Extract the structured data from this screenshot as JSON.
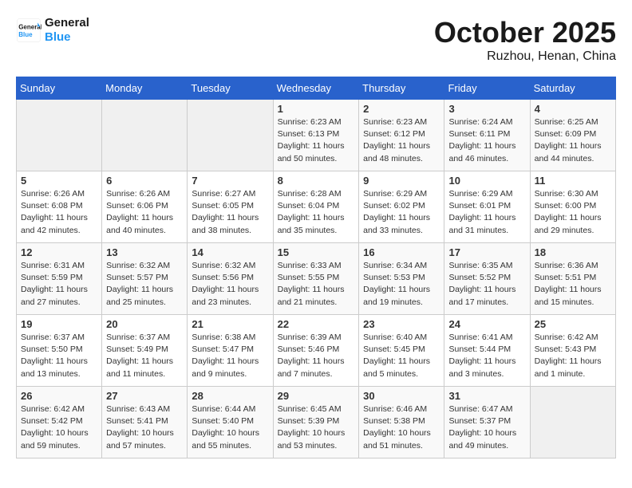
{
  "header": {
    "logo_line1": "General",
    "logo_line2": "Blue",
    "title": "October 2025",
    "subtitle": "Ruzhou, Henan, China"
  },
  "days_of_week": [
    "Sunday",
    "Monday",
    "Tuesday",
    "Wednesday",
    "Thursday",
    "Friday",
    "Saturday"
  ],
  "weeks": [
    [
      {
        "day": "",
        "empty": true
      },
      {
        "day": "",
        "empty": true
      },
      {
        "day": "",
        "empty": true
      },
      {
        "day": "1",
        "sunrise": "6:23 AM",
        "sunset": "6:13 PM",
        "daylight": "11 hours and 50 minutes."
      },
      {
        "day": "2",
        "sunrise": "6:23 AM",
        "sunset": "6:12 PM",
        "daylight": "11 hours and 48 minutes."
      },
      {
        "day": "3",
        "sunrise": "6:24 AM",
        "sunset": "6:11 PM",
        "daylight": "11 hours and 46 minutes."
      },
      {
        "day": "4",
        "sunrise": "6:25 AM",
        "sunset": "6:09 PM",
        "daylight": "11 hours and 44 minutes."
      }
    ],
    [
      {
        "day": "5",
        "sunrise": "6:26 AM",
        "sunset": "6:08 PM",
        "daylight": "11 hours and 42 minutes."
      },
      {
        "day": "6",
        "sunrise": "6:26 AM",
        "sunset": "6:06 PM",
        "daylight": "11 hours and 40 minutes."
      },
      {
        "day": "7",
        "sunrise": "6:27 AM",
        "sunset": "6:05 PM",
        "daylight": "11 hours and 38 minutes."
      },
      {
        "day": "8",
        "sunrise": "6:28 AM",
        "sunset": "6:04 PM",
        "daylight": "11 hours and 35 minutes."
      },
      {
        "day": "9",
        "sunrise": "6:29 AM",
        "sunset": "6:02 PM",
        "daylight": "11 hours and 33 minutes."
      },
      {
        "day": "10",
        "sunrise": "6:29 AM",
        "sunset": "6:01 PM",
        "daylight": "11 hours and 31 minutes."
      },
      {
        "day": "11",
        "sunrise": "6:30 AM",
        "sunset": "6:00 PM",
        "daylight": "11 hours and 29 minutes."
      }
    ],
    [
      {
        "day": "12",
        "sunrise": "6:31 AM",
        "sunset": "5:59 PM",
        "daylight": "11 hours and 27 minutes."
      },
      {
        "day": "13",
        "sunrise": "6:32 AM",
        "sunset": "5:57 PM",
        "daylight": "11 hours and 25 minutes."
      },
      {
        "day": "14",
        "sunrise": "6:32 AM",
        "sunset": "5:56 PM",
        "daylight": "11 hours and 23 minutes."
      },
      {
        "day": "15",
        "sunrise": "6:33 AM",
        "sunset": "5:55 PM",
        "daylight": "11 hours and 21 minutes."
      },
      {
        "day": "16",
        "sunrise": "6:34 AM",
        "sunset": "5:53 PM",
        "daylight": "11 hours and 19 minutes."
      },
      {
        "day": "17",
        "sunrise": "6:35 AM",
        "sunset": "5:52 PM",
        "daylight": "11 hours and 17 minutes."
      },
      {
        "day": "18",
        "sunrise": "6:36 AM",
        "sunset": "5:51 PM",
        "daylight": "11 hours and 15 minutes."
      }
    ],
    [
      {
        "day": "19",
        "sunrise": "6:37 AM",
        "sunset": "5:50 PM",
        "daylight": "11 hours and 13 minutes."
      },
      {
        "day": "20",
        "sunrise": "6:37 AM",
        "sunset": "5:49 PM",
        "daylight": "11 hours and 11 minutes."
      },
      {
        "day": "21",
        "sunrise": "6:38 AM",
        "sunset": "5:47 PM",
        "daylight": "11 hours and 9 minutes."
      },
      {
        "day": "22",
        "sunrise": "6:39 AM",
        "sunset": "5:46 PM",
        "daylight": "11 hours and 7 minutes."
      },
      {
        "day": "23",
        "sunrise": "6:40 AM",
        "sunset": "5:45 PM",
        "daylight": "11 hours and 5 minutes."
      },
      {
        "day": "24",
        "sunrise": "6:41 AM",
        "sunset": "5:44 PM",
        "daylight": "11 hours and 3 minutes."
      },
      {
        "day": "25",
        "sunrise": "6:42 AM",
        "sunset": "5:43 PM",
        "daylight": "11 hours and 1 minute."
      }
    ],
    [
      {
        "day": "26",
        "sunrise": "6:42 AM",
        "sunset": "5:42 PM",
        "daylight": "10 hours and 59 minutes."
      },
      {
        "day": "27",
        "sunrise": "6:43 AM",
        "sunset": "5:41 PM",
        "daylight": "10 hours and 57 minutes."
      },
      {
        "day": "28",
        "sunrise": "6:44 AM",
        "sunset": "5:40 PM",
        "daylight": "10 hours and 55 minutes."
      },
      {
        "day": "29",
        "sunrise": "6:45 AM",
        "sunset": "5:39 PM",
        "daylight": "10 hours and 53 minutes."
      },
      {
        "day": "30",
        "sunrise": "6:46 AM",
        "sunset": "5:38 PM",
        "daylight": "10 hours and 51 minutes."
      },
      {
        "day": "31",
        "sunrise": "6:47 AM",
        "sunset": "5:37 PM",
        "daylight": "10 hours and 49 minutes."
      },
      {
        "day": "",
        "empty": true
      }
    ]
  ]
}
